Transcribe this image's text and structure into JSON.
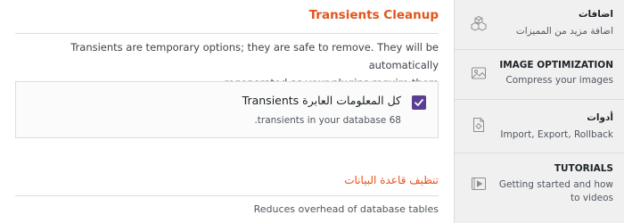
{
  "main": {
    "section_title": "Transients Cleanup",
    "description_line1": "Transients are temporary options; they are safe to remove. They will be automatically",
    "description_line2": "regenerated as your plugins require them.",
    "card": {
      "checkbox_label": "كل المعلومات العابرة Transients",
      "count_text": "68 transients in your database."
    },
    "database_section_title": "تنظيف قاعدة البيانات",
    "database_description": "Reduces overhead of database tables"
  },
  "sidebar": {
    "items": [
      {
        "title": "اضافات",
        "subtitle": "اضافة مزيد من المميزات",
        "icon": "boxes-icon"
      },
      {
        "title": "IMAGE OPTIMIZATION",
        "subtitle": "Compress your images",
        "icon": "image-icon"
      },
      {
        "title": "أدوات",
        "subtitle": "Import, Export, Rollback",
        "icon": "tools-file-icon"
      },
      {
        "title": "TUTORIALS",
        "subtitle": "Getting started and how to videos",
        "icon": "play-video-icon"
      }
    ]
  },
  "colors": {
    "accent": "#e2541c",
    "checkbox": "#5b3e91",
    "sidebar_bg": "#f0f0f1"
  }
}
